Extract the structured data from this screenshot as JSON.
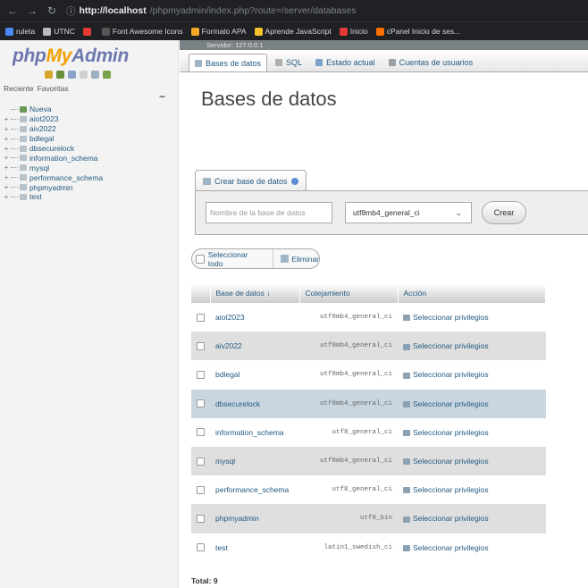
{
  "browser": {
    "url_host": "http://localhost",
    "url_path": "/phpmyadmin/index.php?route=/server/databases",
    "bookmarks": [
      {
        "label": "ruleta",
        "color": "#4c8bf5"
      },
      {
        "label": "UTNC",
        "color": "#bbbbbb"
      },
      {
        "label": "",
        "color": "#e53935"
      },
      {
        "label": "Font Awesome Icons",
        "color": "#555555"
      },
      {
        "label": "Formato APA",
        "color": "#f9a825"
      },
      {
        "label": "Aprende JavaScript",
        "color": "#fbc02d"
      },
      {
        "label": "Inicio",
        "color": "#e53935"
      },
      {
        "label": "cPanel Inicio de ses...",
        "color": "#ff6f00"
      }
    ]
  },
  "sidebar": {
    "logo_php": "php",
    "logo_my": "My",
    "logo_admin": "Admin",
    "recent": "Reciente",
    "favorites": "Favoritas",
    "collapse": "−",
    "tree": [
      {
        "label": "Nueva",
        "type": "nueva"
      },
      {
        "label": "aiot2023",
        "type": "db"
      },
      {
        "label": "aiv2022",
        "type": "db"
      },
      {
        "label": "bdlegal",
        "type": "db"
      },
      {
        "label": "dbsecurelock",
        "type": "db"
      },
      {
        "label": "information_schema",
        "type": "db"
      },
      {
        "label": "mysql",
        "type": "db"
      },
      {
        "label": "performance_schema",
        "type": "db"
      },
      {
        "label": "phpmyadmin",
        "type": "db"
      },
      {
        "label": "test",
        "type": "db"
      }
    ]
  },
  "main": {
    "server_label": "Servidor: 127.0.0.1",
    "tabs": [
      {
        "label": "Bases de datos",
        "active": true
      },
      {
        "label": "SQL",
        "active": false
      },
      {
        "label": "Estado actual",
        "active": false
      },
      {
        "label": "Cuentas de usuarios",
        "active": false
      }
    ],
    "heading": "Bases de datos",
    "create_tab": "Crear base de datos",
    "db_name_placeholder": "Nombre de la base de datos",
    "collation_selected": "utf8mb4_general_ci",
    "create_button": "Crear",
    "select_all": "Seleccionar todo",
    "delete": "Eliminar",
    "table": {
      "headers": [
        "Base de datos",
        "Cotejamiento",
        "Acción"
      ],
      "sort_indicator": "↓",
      "rows": [
        {
          "name": "aiot2023",
          "collation": "utf8mb4_general_ci",
          "action": "Seleccionar privilegios",
          "style": "odd"
        },
        {
          "name": "aiv2022",
          "collation": "utf8mb4_general_ci",
          "action": "Seleccionar privilegios",
          "style": "even"
        },
        {
          "name": "bdlegal",
          "collation": "utf8mb4_general_ci",
          "action": "Seleccionar privilegios",
          "style": "odd"
        },
        {
          "name": "dbsecurelock",
          "collation": "utf8mb4_general_ci",
          "action": "Seleccionar privilegios",
          "style": "marked"
        },
        {
          "name": "information_schema",
          "collation": "utf8_general_ci",
          "action": "Seleccionar privilegios",
          "style": "odd"
        },
        {
          "name": "mysql",
          "collation": "utf8mb4_general_ci",
          "action": "Seleccionar privilegios",
          "style": "even"
        },
        {
          "name": "performance_schema",
          "collation": "utf8_general_ci",
          "action": "Seleccionar privilegios",
          "style": "odd"
        },
        {
          "name": "phpmyadmin",
          "collation": "utf8_bin",
          "action": "Seleccionar privilegios",
          "style": "even"
        },
        {
          "name": "test",
          "collation": "latin1_swedish_ci",
          "action": "Seleccionar privilegios",
          "style": "odd"
        }
      ]
    },
    "total": "Total: 9"
  }
}
